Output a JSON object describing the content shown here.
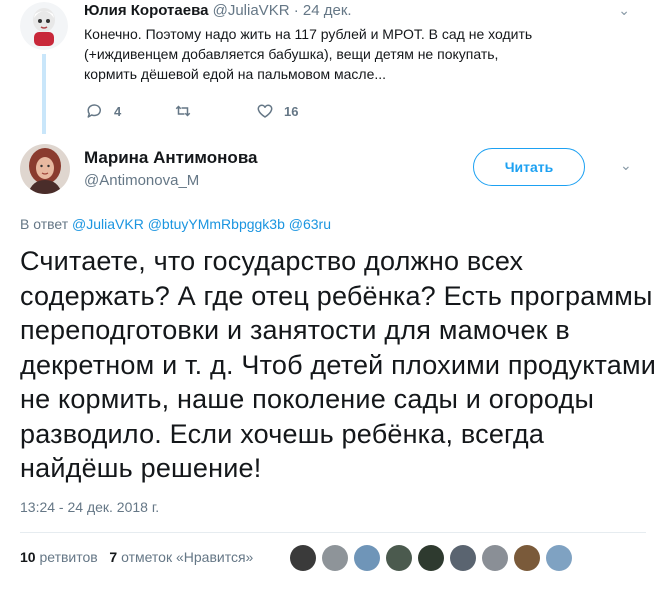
{
  "parent_tweet": {
    "name": "Юлия Коротаева",
    "handle": "@JuliaVKR",
    "time": "· 24 дек.",
    "text": "Конечно. Поэтому надо жить на 117 рублей и МРОТ. В сад не ходить (+иждивенцем добавляется бабушка), вещи детям не покупать, кормить дёшевой едой на пальмовом масле...",
    "replies": "4",
    "retweets": "",
    "likes": "16"
  },
  "tweet": {
    "name": "Марина Антимонова",
    "handle": "@Antimonova_M",
    "follow_label": "Читать",
    "reply_prefix": "В ответ",
    "mentions": "@JuliaVKR @btuyYMmRbpggk3b @63ru",
    "text": "Считаете, что государство должно всех содержать?  А где отец ребёнка? Есть программы переподготовки и занятости для мамочек в декретном и т. д. Чтоб детей плохими продуктами не кормить, наше поколение сады и огороды разводило. Если хочешь ребёнка, всегда найдёшь решение!",
    "timestamp": "13:24 - 24 дек. 2018 г.",
    "retweet_count": "10",
    "retweet_label": "ретвитов",
    "like_count": "7",
    "like_label": "отметок «Нравится»"
  },
  "colors": {
    "link": "#1b95e0",
    "secondary": "#657786",
    "thread": "#c9e6fa"
  },
  "liker_avatars": [
    "dark",
    "gray",
    "blue",
    "dark",
    "green",
    "blue",
    "gray",
    "brown",
    "blue"
  ]
}
